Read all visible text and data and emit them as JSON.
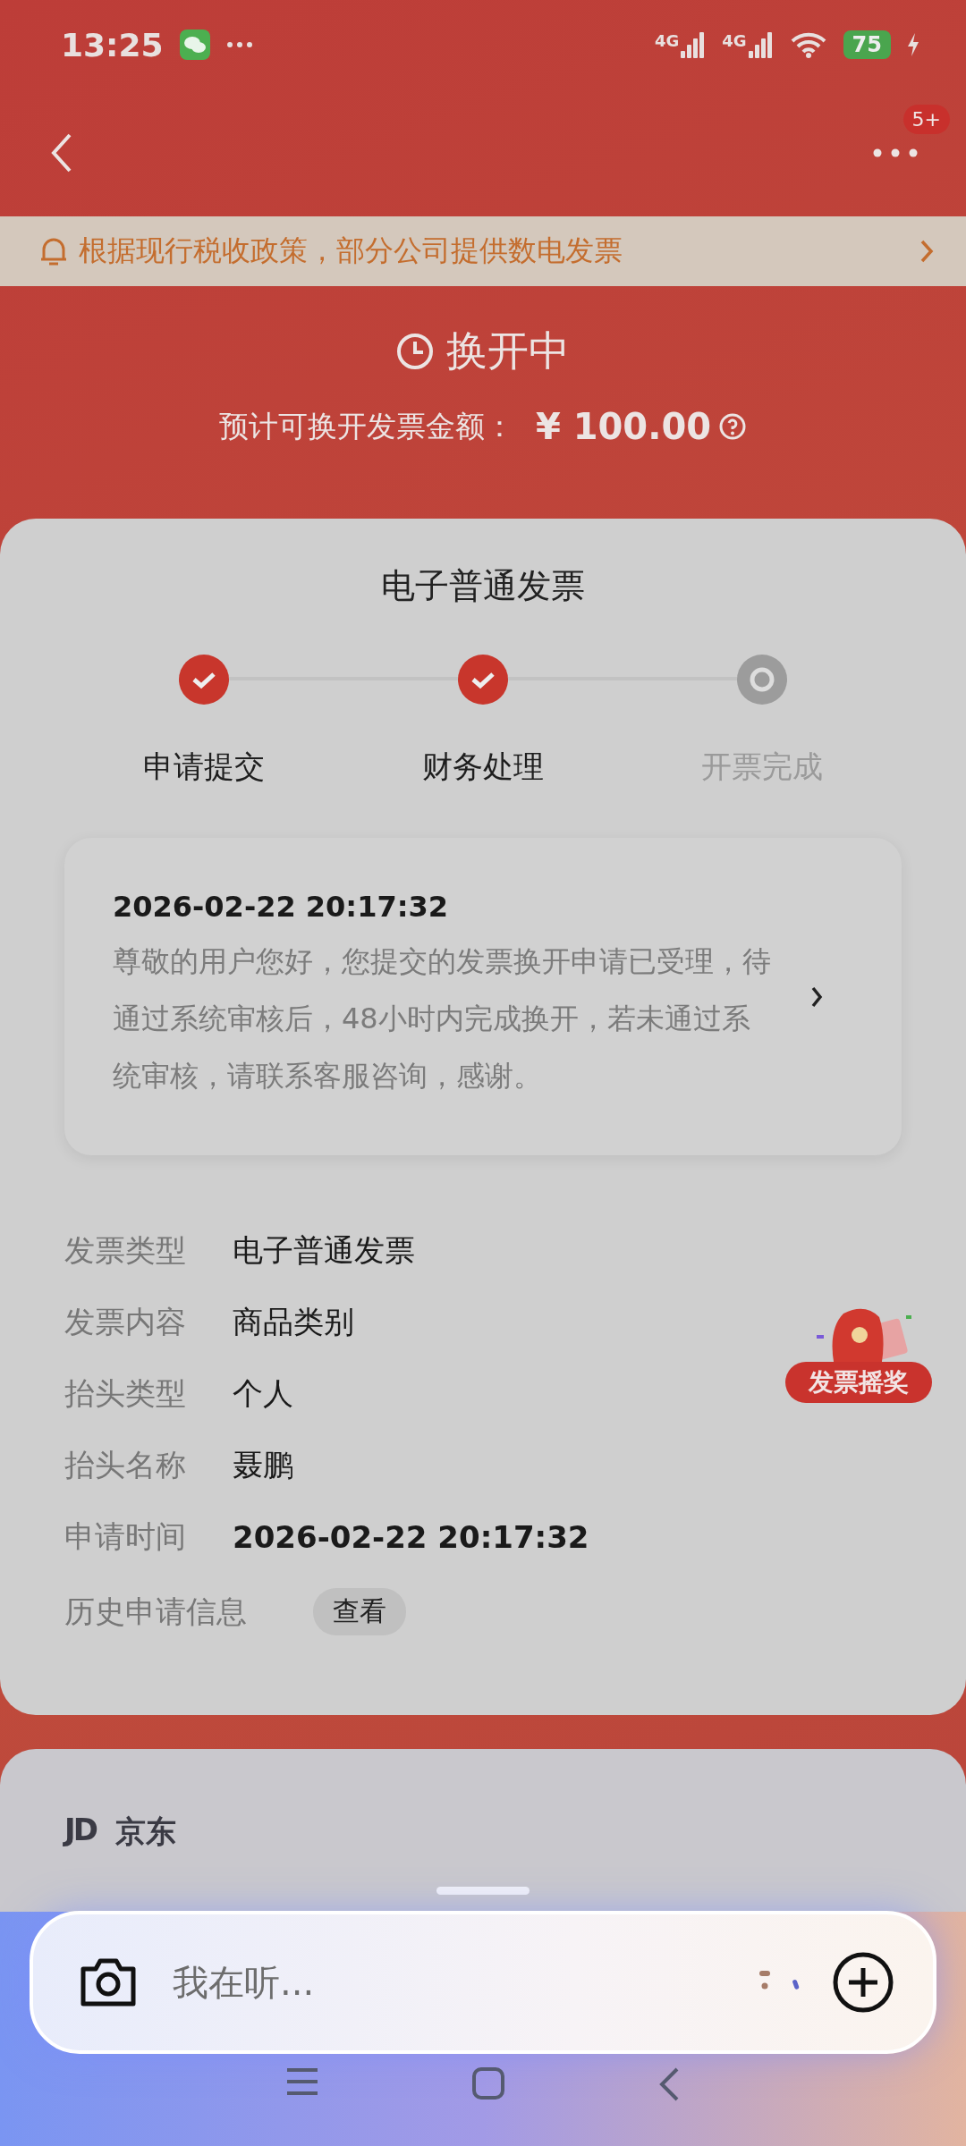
{
  "status_bar": {
    "time": "13:25",
    "networks": [
      "4G",
      "4G"
    ],
    "battery": "75"
  },
  "nav": {
    "badge": "5+"
  },
  "notice": {
    "text": "根据现行税收政策，部分公司提供数电发票"
  },
  "status": {
    "title": "换开中",
    "amount_label": "预计可换开发票金额：",
    "amount": "¥ 100.00"
  },
  "invoice": {
    "title": "电子普通发票",
    "steps": [
      {
        "label": "申请提交",
        "done": true
      },
      {
        "label": "财务处理",
        "done": true
      },
      {
        "label": "开票完成",
        "done": false
      }
    ],
    "message": {
      "time": "2026-02-22 20:17:32",
      "text": "尊敬的用户您好，您提交的发票换开申请已受理，待通过系统审核后，48小时内完成换开，若未通过系统审核，请联系客服咨询，感谢。"
    },
    "details": [
      {
        "label": "发票类型",
        "value": "电子普通发票",
        "kind": "text"
      },
      {
        "label": "发票内容",
        "value": "商品类别",
        "kind": "text"
      },
      {
        "label": "抬头类型",
        "value": "个人",
        "kind": "text"
      },
      {
        "label": "抬头名称",
        "value": "聂鹏",
        "kind": "text"
      },
      {
        "label": "申请时间",
        "value": "2026-02-22 20:17:32",
        "kind": "number"
      },
      {
        "label": "历史申请信息",
        "value": "查看",
        "kind": "button"
      }
    ],
    "lottery": {
      "label": "发票摇奖"
    }
  },
  "shop": {
    "logo": "JD",
    "name": "京东"
  },
  "assistant": {
    "placeholder": "我在听..."
  }
}
